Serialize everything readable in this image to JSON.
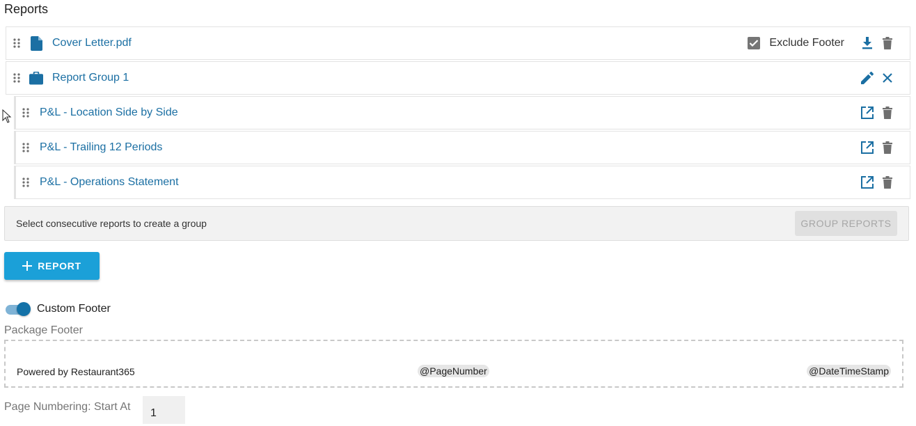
{
  "section": {
    "title": "Reports"
  },
  "reports": {
    "cover_letter": {
      "label": "Cover Letter.pdf",
      "icon": "file-icon",
      "exclude_footer_label": "Exclude Footer",
      "exclude_footer_checked": true
    },
    "group": {
      "label": "Report Group 1",
      "icon": "briefcase-icon"
    },
    "children": [
      {
        "label": "P&L - Location Side by Side"
      },
      {
        "label": "P&L - Trailing 12 Periods"
      },
      {
        "label": "P&L - Operations Statement"
      }
    ]
  },
  "group_bar": {
    "hint": "Select consecutive reports to create a group",
    "button_label": "GROUP REPORTS"
  },
  "add_button": {
    "label": "REPORT"
  },
  "custom_footer": {
    "toggle_label": "Custom Footer",
    "enabled": true,
    "package_footer_label": "Package Footer",
    "left_text": "Powered by Restaurant365",
    "center_token": "@PageNumber",
    "right_token": "@DateTimeStamp"
  },
  "page_numbering": {
    "label": "Page Numbering: Start At",
    "value": "1"
  },
  "colors": {
    "link": "#1b6fa3",
    "primary": "#1ba0d8",
    "icon_gray": "#6f6f6f"
  }
}
